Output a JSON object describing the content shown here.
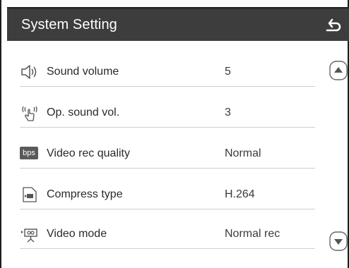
{
  "header": {
    "title": "System Setting"
  },
  "settings": [
    {
      "label": "Sound volume",
      "value": "5",
      "icon": "speaker-icon"
    },
    {
      "label": "Op. sound vol.",
      "value": "3",
      "icon": "touch-sound-icon"
    },
    {
      "label": "Video rec quality",
      "value": "Normal",
      "icon": "bps-icon",
      "icon_text": "bps"
    },
    {
      "label": "Compress type",
      "value": "H.264",
      "icon": "compress-icon"
    },
    {
      "label": "Video mode",
      "value": "Normal rec",
      "icon": "video-mode-icon"
    }
  ],
  "colors": {
    "header_bg": "#3d3d3d",
    "text": "#2a2a2a",
    "divider": "#cfcfcf"
  }
}
